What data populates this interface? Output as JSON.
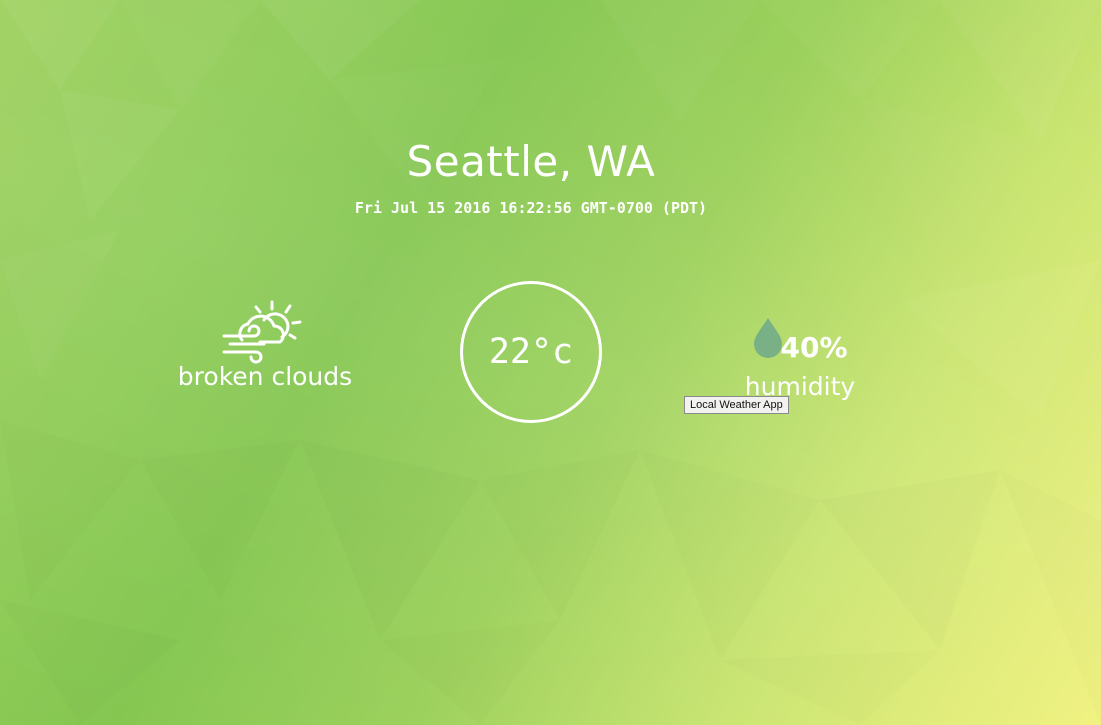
{
  "location": {
    "city": "Seattle, WA",
    "datetime": "Fri Jul 15 2016 16:22:56 GMT-0700 (PDT)"
  },
  "weather": {
    "icon": "windy-partly-cloudy-icon",
    "description": "broken clouds"
  },
  "temperature": {
    "value": "22°c"
  },
  "humidity": {
    "icon": "water-drop-icon",
    "value": "40%",
    "label": "humidity"
  },
  "tooltip": {
    "text": "Local Weather App"
  },
  "colors": {
    "text": "#ffffff",
    "background_top_right": "#eff07a",
    "background_bottom_left": "#5fae43",
    "drop": "#6fa88a"
  }
}
